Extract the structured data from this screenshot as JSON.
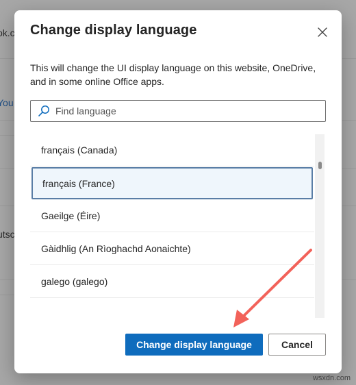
{
  "background": {
    "fragments": [
      "ok.c",
      "You",
      "utsc"
    ]
  },
  "dialog": {
    "title": "Change display language",
    "description": "This will change the UI display language on this website, OneDrive, and in some online Office apps.",
    "close_icon": "close-icon"
  },
  "search": {
    "placeholder": "Find language",
    "value": "",
    "icon": "search-icon"
  },
  "languages": [
    {
      "label": "français (Canada)",
      "selected": false
    },
    {
      "label": "français (France)",
      "selected": true
    },
    {
      "label": "Gaeilge (Éire)",
      "selected": false
    },
    {
      "label": "Gàidhlig (An Rìoghachd Aonaichte)",
      "selected": false
    },
    {
      "label": "galego (galego)",
      "selected": false
    }
  ],
  "buttons": {
    "primary_label": "Change display language",
    "secondary_label": "Cancel"
  },
  "colors": {
    "primary": "#0f6cbd",
    "annotation_arrow": "#f2625a",
    "selected_bg": "#eff6fc"
  },
  "watermark": "wsxdn.com"
}
